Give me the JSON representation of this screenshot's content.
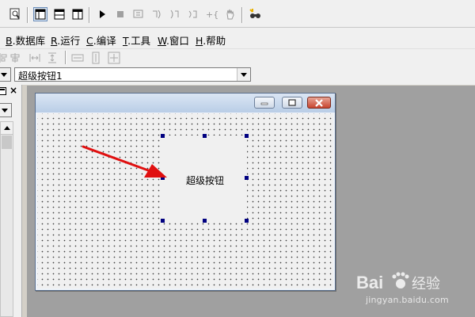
{
  "toolbar": {
    "icons": [
      "preview-icon",
      "form-layout-icon",
      "form-layout-2-icon",
      "form-layout-3-icon",
      "run-icon",
      "stop-icon",
      "step-into-icon",
      "step-over-icon",
      "step-out-icon",
      "run-to-cursor-icon",
      "breakpoint-icon",
      "hand-icon",
      "find-icon"
    ]
  },
  "menu": {
    "items": [
      {
        "key": "B",
        "label": "数据库"
      },
      {
        "key": "R",
        "label": "运行"
      },
      {
        "key": "C",
        "label": "编译"
      },
      {
        "key": "T",
        "label": "工具"
      },
      {
        "key": "W",
        "label": "窗口"
      },
      {
        "key": "H",
        "label": "帮助"
      }
    ]
  },
  "control_selector": {
    "selected": "超级按钮1"
  },
  "form": {
    "control_label": "超级按钮"
  },
  "watermark": {
    "brand": "Bai",
    "brand2": "经验",
    "url": "jingyan.baidu.com"
  },
  "colors": {
    "workspace": "#a0a0a0",
    "selection_handle": "#000080",
    "arrow": "#e01010",
    "close_button": "#c8452f"
  }
}
